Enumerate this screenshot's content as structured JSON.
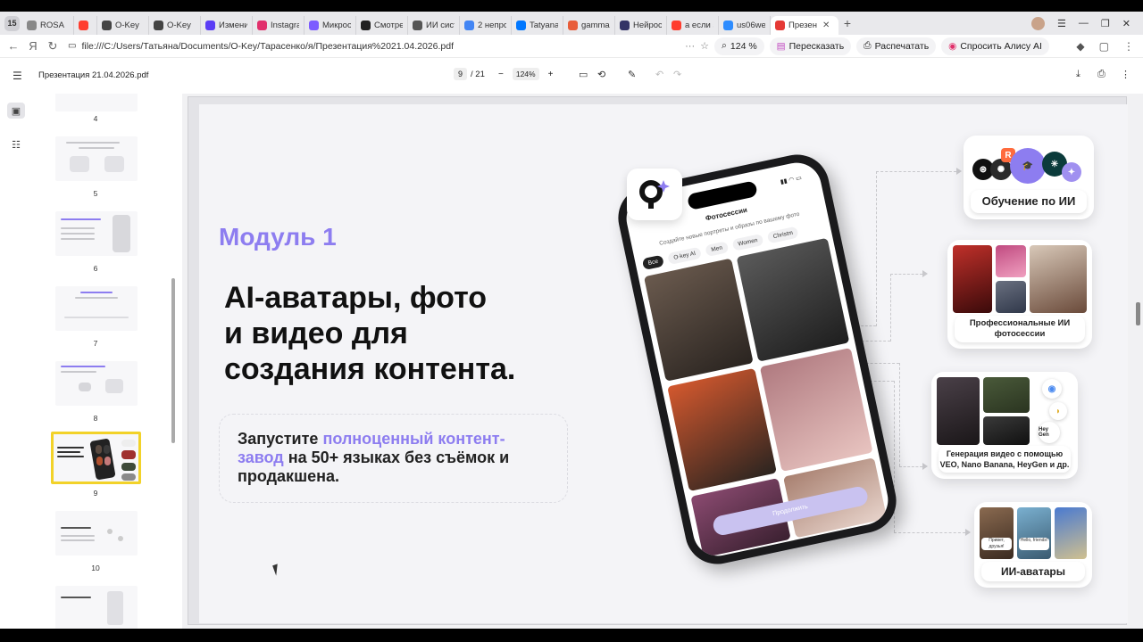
{
  "browser": {
    "tab_count": "15",
    "tabs": [
      {
        "label": "ROSA",
        "color": "#888888"
      },
      {
        "label": "",
        "color": "#ff3d2e"
      },
      {
        "label": "O-Key",
        "color": "#444444"
      },
      {
        "label": "O-Key",
        "color": "#444444"
      },
      {
        "label": "Изменит",
        "color": "#5b3df5"
      },
      {
        "label": "Instagram",
        "color": "#e1306c"
      },
      {
        "label": "Микрооб",
        "color": "#7c5cff"
      },
      {
        "label": "Смотрет",
        "color": "#222222"
      },
      {
        "label": "ИИ систе",
        "color": "#555555"
      },
      {
        "label": "2 непроч",
        "color": "#4285f4"
      },
      {
        "label": "Tatyana",
        "color": "#0077ff"
      },
      {
        "label": "gamma –",
        "color": "#e85d3a"
      },
      {
        "label": "Нейросе",
        "color": "#333366"
      },
      {
        "label": "а если за",
        "color": "#ff3d2e"
      },
      {
        "label": "us06web",
        "color": "#2d8cff"
      },
      {
        "label": "Презен",
        "color": "#e53935",
        "active": true
      }
    ],
    "url": "file:///C:/Users/Татьяна/Documents/O-Key/Тарасенко/я/Презентация%2021.04.2026.pdf",
    "zoom": "124 %",
    "retell_label": "Пересказать",
    "print_label": "Распечатать",
    "alice_label": "Спросить Алису AI"
  },
  "pdf": {
    "title": "Презентация 21.04.2026.pdf",
    "current_page": "9",
    "total_pages": "/ 21",
    "zoom": "124%",
    "thumbnail_numbers": [
      "4",
      "5",
      "6",
      "7",
      "8",
      "9",
      "10"
    ]
  },
  "slide": {
    "module": "Модуль 1",
    "headline_1": "AI-аватары, фото",
    "headline_2": "и видео для",
    "headline_3": "создания контента.",
    "info_pre": "Запустите ",
    "info_accent": "полноценный контент-завод",
    "info_post": " на 50+ языках без съёмок и продакшена.",
    "accent_color": "#8d7df0",
    "phone": {
      "header": "Фотосессии",
      "subtitle": "Создайте новые портреты и образы по вашему фото",
      "chips": [
        "Все",
        "O-key AI",
        "Men",
        "Women",
        "Christm"
      ],
      "button": "Продолжить"
    },
    "cards": {
      "learning": "Обучение по ИИ",
      "photosession": "Профессиональные ИИ фотосессии",
      "video": "Генерация видео с помощью VEO, Nano Banana, HeyGen и др.",
      "avatars": "ИИ-аватары",
      "heygen_label": "Hey Gen",
      "avatar_caption_1": "Привет, друзья!",
      "avatar_caption_2": "Hello, friends!"
    }
  }
}
